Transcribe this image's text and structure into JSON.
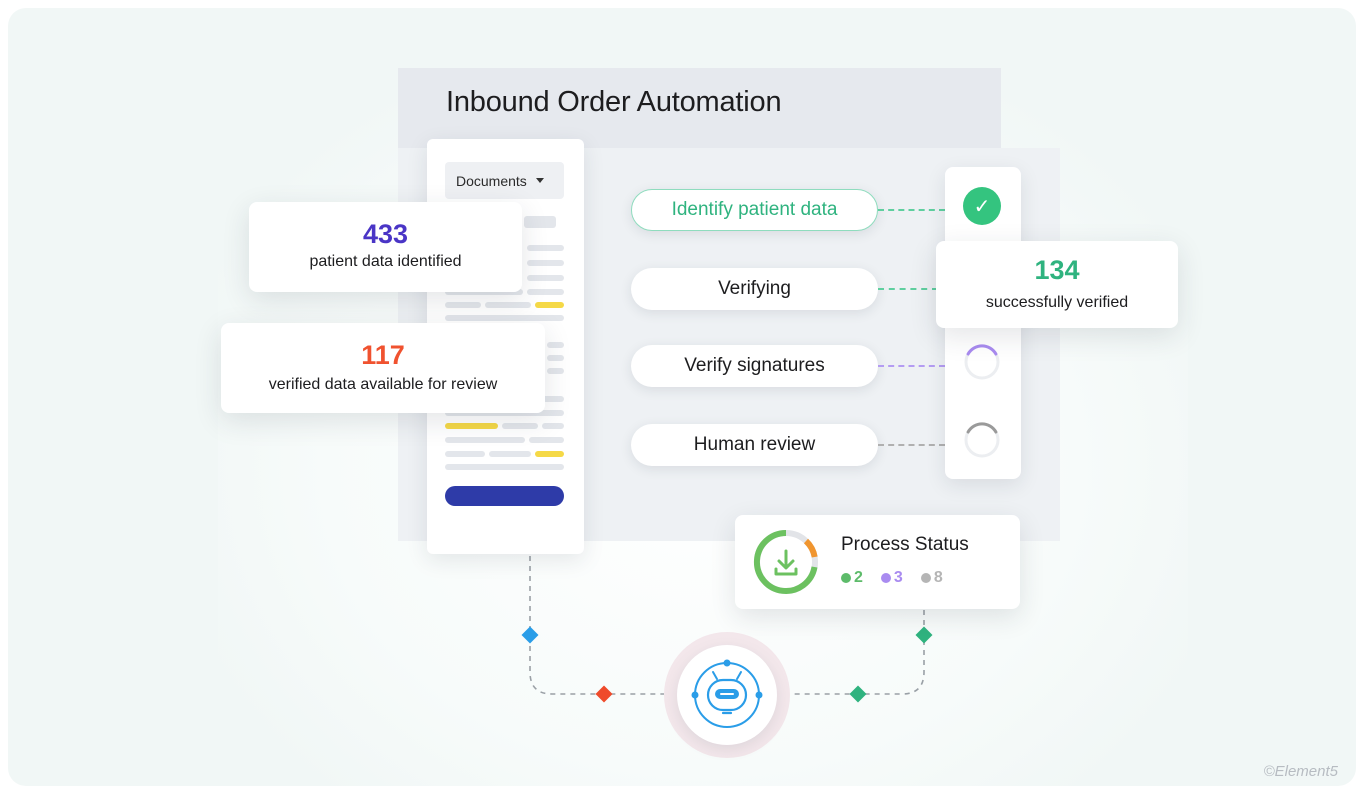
{
  "header": {
    "title": "Inbound Order Automation"
  },
  "document_panel": {
    "dropdown_label": "Documents"
  },
  "stats": [
    {
      "value": "433",
      "label": "patient data identified",
      "color": "#4a35c6"
    },
    {
      "value": "117",
      "label": "verified data available for review",
      "color": "#f0522f"
    },
    {
      "value": "134",
      "label": "successfully verified",
      "color": "#2fb37f"
    }
  ],
  "steps": [
    {
      "label": "Identify patient data",
      "state": "done",
      "color": "#34c47f"
    },
    {
      "label": "Verifying",
      "state": "in-progress",
      "color": "#34c47f"
    },
    {
      "label": "Verify signatures",
      "state": "pending",
      "color": "#a98bf0"
    },
    {
      "label": "Human review",
      "state": "pending",
      "color": "#9a9a9a"
    }
  ],
  "process_status": {
    "title": "Process Status",
    "counts": [
      {
        "value": "2",
        "color": "#5dbb6a"
      },
      {
        "value": "3",
        "color": "#a98bf0"
      },
      {
        "value": "8",
        "color": "#b5b5b5"
      }
    ]
  },
  "watermark": "©Element5"
}
